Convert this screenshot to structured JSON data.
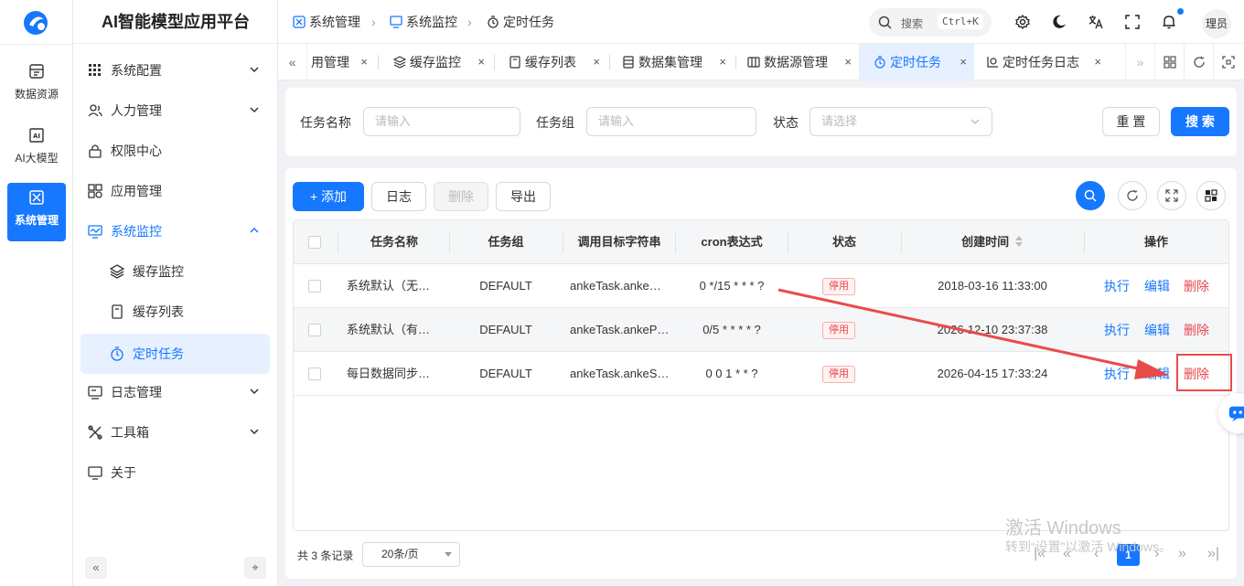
{
  "colors": {
    "primary": "#1677ff",
    "danger": "#e5484d",
    "annotation": "#e94b4b"
  },
  "rail": {
    "items": [
      {
        "label": "数据资源",
        "icon": "database-icon"
      },
      {
        "label": "AI大模型",
        "icon": "ai-chip-icon"
      },
      {
        "label": "系统管理",
        "icon": "system-icon",
        "active": true
      }
    ]
  },
  "sidebar": {
    "title": "AI智能模型应用平台",
    "menu": [
      {
        "label": "系统配置",
        "icon": "grid-icon"
      },
      {
        "label": "人力管理",
        "icon": "users-icon"
      },
      {
        "label": "权限中心",
        "icon": "lock-icon"
      },
      {
        "label": "应用管理",
        "icon": "apps-icon"
      },
      {
        "label": "系统监控",
        "icon": "monitor-icon",
        "open": true
      },
      {
        "label": "缓存监控",
        "icon": "layers-icon"
      },
      {
        "label": "缓存列表",
        "icon": "notes-icon"
      },
      {
        "label": "定时任务",
        "icon": "timer-icon",
        "selected": true
      },
      {
        "label": "日志管理",
        "icon": "log-icon"
      },
      {
        "label": "工具箱",
        "icon": "tools-icon"
      },
      {
        "label": "关于",
        "icon": "info-icon"
      }
    ],
    "collapse_glyph": "«",
    "pin_glyph": "⌖"
  },
  "header": {
    "breadcrumb": [
      {
        "label": "系统管理",
        "icon": "system-icon"
      },
      {
        "label": "系统监控",
        "icon": "monitor-icon"
      },
      {
        "label": "定时任务",
        "icon": "timer-icon"
      }
    ],
    "search": {
      "label": "搜索",
      "shortcut": "Ctrl+K"
    },
    "avatar_text": "理员"
  },
  "tabs": {
    "items": [
      {
        "label": "用管理",
        "icon": ""
      },
      {
        "label": "缓存监控",
        "icon": "layers-icon"
      },
      {
        "label": "缓存列表",
        "icon": "notes-icon"
      },
      {
        "label": "数据集管理",
        "icon": "dataset-icon"
      },
      {
        "label": "数据源管理",
        "icon": "datasource-icon"
      },
      {
        "label": "定时任务",
        "icon": "timer-icon",
        "active": true
      },
      {
        "label": "定时任务日志",
        "icon": "chart-icon"
      }
    ],
    "close_glyph": "×",
    "scroll_left": "«",
    "scroll_right": "»"
  },
  "filters": {
    "task_name": {
      "label": "任务名称",
      "placeholder": "请输入"
    },
    "task_group": {
      "label": "任务组",
      "placeholder": "请输入"
    },
    "status": {
      "label": "状态",
      "placeholder": "请选择"
    },
    "reset": "重 置",
    "search": "搜 索"
  },
  "toolbar": {
    "add": "+ 添加",
    "log": "日志",
    "delete": "删除",
    "export": "导出"
  },
  "table": {
    "columns": [
      "任务名称",
      "任务组",
      "调用目标字符串",
      "cron表达式",
      "状态",
      "创建时间",
      "操作"
    ],
    "rows": [
      {
        "name": "系统默认（无…",
        "group": "DEFAULT",
        "target": "ankeTask.anke…",
        "cron": "0 */15 * * * ?",
        "status": "停用",
        "created": "2018-03-16 11:33:00"
      },
      {
        "name": "系统默认（有…",
        "group": "DEFAULT",
        "target": "ankeTask.ankeP…",
        "cron": "0/5 * * * * ?",
        "status": "停用",
        "created": "2026-12-10 23:37:38"
      },
      {
        "name": "每日数据同步…",
        "group": "DEFAULT",
        "target": "ankeTask.ankeS…",
        "cron": "0 0 1 * * ?",
        "status": "停用",
        "created": "2026-04-15 17:33:24"
      }
    ],
    "actions": {
      "run": "执行",
      "edit": "编辑",
      "delete": "删除"
    }
  },
  "pagination": {
    "total": "共 3 条记录",
    "page_size": "20条/页",
    "current": "1",
    "first": "|«",
    "prev_many": "«",
    "prev": "‹",
    "next": "›",
    "next_many": "»",
    "last": "»|"
  },
  "watermark": {
    "title": "激活 Windows",
    "subtitle": "转到“设置”以激活 Windows。"
  }
}
